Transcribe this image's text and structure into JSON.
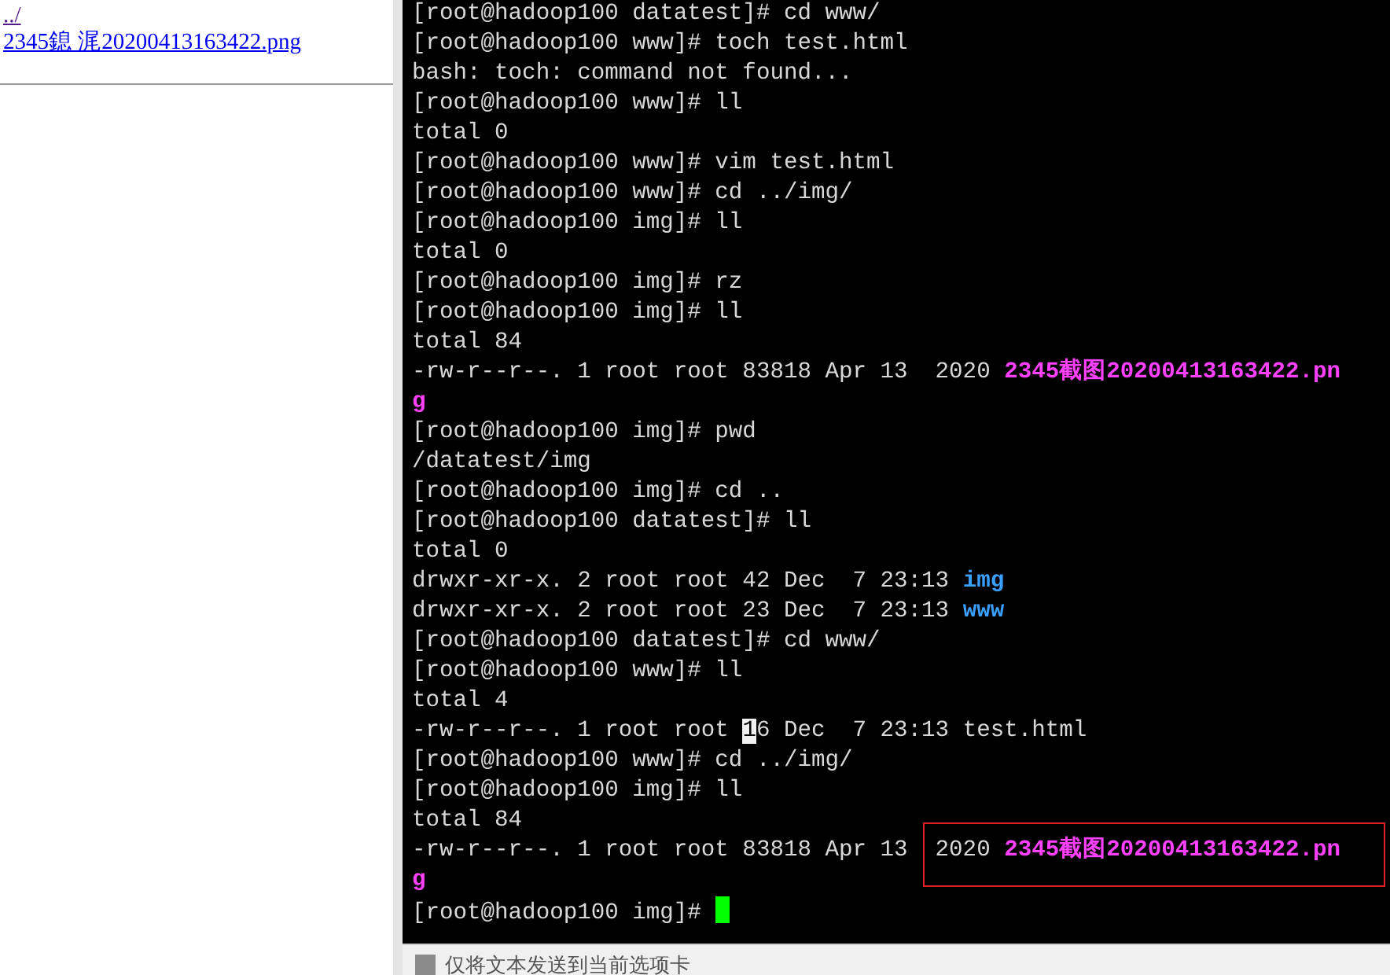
{
  "directory_listing": {
    "links": [
      {
        "text": "../",
        "visited": true
      },
      {
        "text": "2345鎴  浘20200413163422.png",
        "visited": false
      }
    ]
  },
  "terminal": {
    "lines": [
      [
        {
          "kind": "plain",
          "text": "[root@hadoop100 datatest]# cd www/"
        }
      ],
      [
        {
          "kind": "plain",
          "text": "[root@hadoop100 www]# toch test.html"
        }
      ],
      [
        {
          "kind": "plain",
          "text": "bash: toch: command not found..."
        }
      ],
      [
        {
          "kind": "plain",
          "text": "[root@hadoop100 www]# ll"
        }
      ],
      [
        {
          "kind": "plain",
          "text": "total 0"
        }
      ],
      [
        {
          "kind": "plain",
          "text": "[root@hadoop100 www]# vim test.html"
        }
      ],
      [
        {
          "kind": "plain",
          "text": "[root@hadoop100 www]# cd ../img/"
        }
      ],
      [
        {
          "kind": "plain",
          "text": "[root@hadoop100 img]# ll"
        }
      ],
      [
        {
          "kind": "plain",
          "text": "total 0"
        }
      ],
      [
        {
          "kind": "plain",
          "text": "[root@hadoop100 img]# rz"
        }
      ],
      [
        {
          "kind": "plain",
          "text": "[root@hadoop100 img]# ll"
        }
      ],
      [
        {
          "kind": "plain",
          "text": "total 84"
        }
      ],
      [
        {
          "kind": "plain",
          "text": "-rw-r--r--. 1 root root 83818 Apr 13  2020 "
        },
        {
          "kind": "image",
          "text": "2345截图20200413163422.pn"
        }
      ],
      [
        {
          "kind": "image",
          "text": "g"
        }
      ],
      [
        {
          "kind": "plain",
          "text": "[root@hadoop100 img]# pwd"
        }
      ],
      [
        {
          "kind": "plain",
          "text": "/datatest/img"
        }
      ],
      [
        {
          "kind": "plain",
          "text": "[root@hadoop100 img]# cd .."
        }
      ],
      [
        {
          "kind": "plain",
          "text": "[root@hadoop100 datatest]# ll"
        }
      ],
      [
        {
          "kind": "plain",
          "text": "total 0"
        }
      ],
      [
        {
          "kind": "plain",
          "text": "drwxr-xr-x. 2 root root 42 Dec  7 23:13 "
        },
        {
          "kind": "dir",
          "text": "img"
        }
      ],
      [
        {
          "kind": "plain",
          "text": "drwxr-xr-x. 2 root root 23 Dec  7 23:13 "
        },
        {
          "kind": "dir",
          "text": "www"
        }
      ],
      [
        {
          "kind": "plain",
          "text": "[root@hadoop100 datatest]# cd www/"
        }
      ],
      [
        {
          "kind": "plain",
          "text": "[root@hadoop100 www]# ll"
        }
      ],
      [
        {
          "kind": "plain",
          "text": "total 4"
        }
      ],
      [
        {
          "kind": "plain",
          "text": "-rw-r--r--. 1 root root "
        },
        {
          "kind": "selected",
          "text": "1"
        },
        {
          "kind": "plain",
          "text": "6 Dec  7 23:13 test.html"
        }
      ],
      [
        {
          "kind": "plain",
          "text": "[root@hadoop100 www]# cd ../img/"
        }
      ],
      [
        {
          "kind": "plain",
          "text": "[root@hadoop100 img]# ll"
        }
      ],
      [
        {
          "kind": "plain",
          "text": "total 84"
        }
      ],
      [
        {
          "kind": "plain",
          "text": "-rw-r--r--. 1 root root 83818 Apr 13  2020 "
        },
        {
          "kind": "image",
          "text": "2345截图20200413163422.pn"
        }
      ],
      [
        {
          "kind": "image",
          "text": "g"
        }
      ],
      [
        {
          "kind": "plain",
          "text": "[root@hadoop100 img]# "
        },
        {
          "kind": "cursor"
        }
      ]
    ]
  },
  "send_bar": {
    "label": "仅将文本发送到当前选项卡"
  }
}
